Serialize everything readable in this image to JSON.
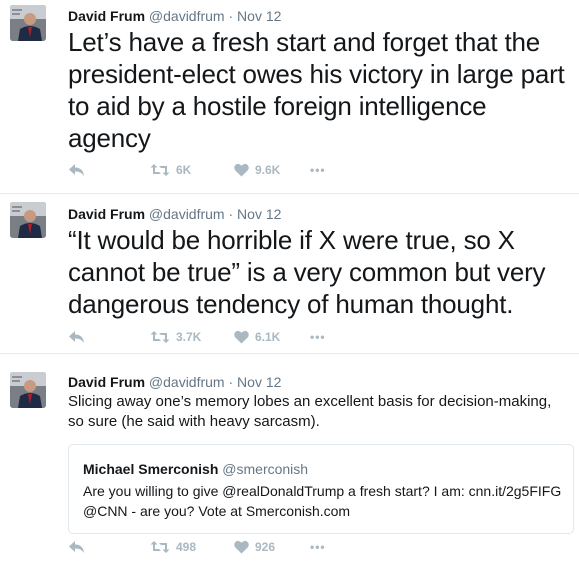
{
  "tweets": [
    {
      "name": "David Frum",
      "handle": "@davidfrum",
      "separator": "·",
      "date": "Nov 12",
      "text": "Let’s have a fresh start and forget that the president-elect owes his victory in large part to aid by a hostile foreign intelligence agency",
      "retweets": "6K",
      "likes": "9.6K",
      "more": "•••"
    },
    {
      "name": "David Frum",
      "handle": "@davidfrum",
      "separator": "·",
      "date": "Nov 12",
      "text": "“It would be horrible if X were true, so X cannot be true” is a very common but very dangerous tendency of human thought.",
      "retweets": "3.7K",
      "likes": "6.1K",
      "more": "•••"
    },
    {
      "name": "David Frum",
      "handle": "@davidfrum",
      "separator": "·",
      "date": "Nov 12",
      "text": "Slicing away one’s memory lobes an excellent basis for decision-making, so sure (he said with heavy sarcasm).",
      "retweets": "498",
      "likes": "926",
      "more": "•••",
      "quote": {
        "name": "Michael Smerconish",
        "handle": "@smerconish",
        "text": "Are you willing to give @realDonaldTrump a fresh start? I am: cnn.it/2g5FIFG @CNN - are you? Vote at Smerconish.com"
      }
    }
  ],
  "colors": {
    "text": "#14171a",
    "secondary": "#657786",
    "icon": "#aab8c2",
    "border": "#e6ecf0"
  }
}
